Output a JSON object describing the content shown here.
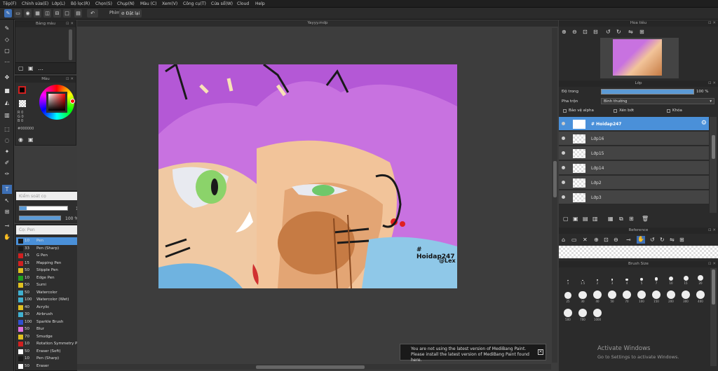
{
  "menu": [
    "Tệp(F)",
    "Chỉnh sửa(E)",
    "Lớp(L)",
    "Bộ lọc(R)",
    "Chọn(S)",
    "Chụp(N)",
    "Màu (C)",
    "Xem(V)",
    "Công cụ(T)",
    "Cửa sổ(W)",
    "Cloud",
    "Help"
  ],
  "toolbar": {
    "hand_label": "Phím",
    "snap_label": "Đặt lại"
  },
  "panels": {
    "brush_color_title": "Bảng màu",
    "color_title": "Màu",
    "color_rgb": [
      "R 0",
      "G 0",
      "B 0"
    ],
    "color_hex": "#000000",
    "brush_control_title": "Kiểm soát cọ",
    "brush_size_value": "10",
    "brush_opacity_value": "100 %",
    "pen_title": "Cọ: Pen",
    "navigator_title": "Hoa tiêu",
    "layer_title": "Lớp",
    "opacity_label": "Độ trong",
    "opacity_value": "100 %",
    "blend_label": "Pha trộn",
    "blend_value": "Bình thường",
    "protect_alpha": "Bảo vệ alpha",
    "clip_label": "Xén bớt",
    "lock_label": "Khóa",
    "reference_title": "Reference",
    "brushsize_title": "Brush Size"
  },
  "document_title": "Yayyy.mdp",
  "layers": [
    {
      "name": "# Hoidap247",
      "selected": true
    },
    {
      "name": "Lớp16",
      "selected": false
    },
    {
      "name": "Lớp15",
      "selected": false
    },
    {
      "name": "Lớp14",
      "selected": false
    },
    {
      "name": "Lớp2",
      "selected": false
    },
    {
      "name": "Lớp3",
      "selected": false
    }
  ],
  "brushes": [
    {
      "size": "10",
      "name": "Pen",
      "color": "#1a1a1a",
      "selected": true
    },
    {
      "size": "33",
      "name": "Pen (Sharp)",
      "color": "#1a1a1a"
    },
    {
      "size": "15",
      "name": "G Pen",
      "color": "#d02020"
    },
    {
      "size": "15",
      "name": "Mapping Pen",
      "color": "#d02020"
    },
    {
      "size": "50",
      "name": "Stipple Pen",
      "color": "#e0c020"
    },
    {
      "size": "10",
      "name": "Edge Pen",
      "color": "#20a020"
    },
    {
      "size": "50",
      "name": "Sumi",
      "color": "#e0c020"
    },
    {
      "size": "50",
      "name": "Watercolor",
      "color": "#40b0d0"
    },
    {
      "size": "100",
      "name": "Watercolor (Wet)",
      "color": "#40b0d0"
    },
    {
      "size": "40",
      "name": "Acrylic",
      "color": "#e0c020"
    },
    {
      "size": "30",
      "name": "Airbrush",
      "color": "#40b0d0"
    },
    {
      "size": "100",
      "name": "Sparkle Brush",
      "color": "#3050d0"
    },
    {
      "size": "50",
      "name": "Blur",
      "color": "#e070e0"
    },
    {
      "size": "70",
      "name": "Smudge",
      "color": "#e0c020"
    },
    {
      "size": "10",
      "name": "Rotation Symmetry P",
      "color": "#d02020"
    },
    {
      "size": "50",
      "name": "Eraser (Soft)",
      "color": "#ffffff"
    },
    {
      "size": "10",
      "name": "Pen (Sharp)",
      "color": "#1a1a1a"
    },
    {
      "size": "50",
      "name": "Eraser",
      "color": "#ffffff"
    }
  ],
  "brush_sizes": [
    "1",
    "1.5",
    "2",
    "3",
    "4",
    "5",
    "7",
    "10",
    "15",
    "20",
    "25",
    "30",
    "40",
    "50",
    "70",
    "100",
    "150",
    "200",
    "300",
    "400",
    "500",
    "700",
    "1000"
  ],
  "art_text": {
    "tag": "# Hoidap247",
    "signature": "@Lex"
  },
  "notice": {
    "line1": "You are not using the latest version of MediBang Paint.",
    "line2": "Please install the latest version of MediBang Paint found here."
  },
  "watermark": {
    "title": "Activate Windows",
    "subtitle": "Go to Settings to activate Windows."
  },
  "colors": {
    "accent": "#4a90d9",
    "menubar": "#1f1f1f",
    "panel": "#2e2e2e",
    "canvas_bg": "#c76ee0"
  }
}
